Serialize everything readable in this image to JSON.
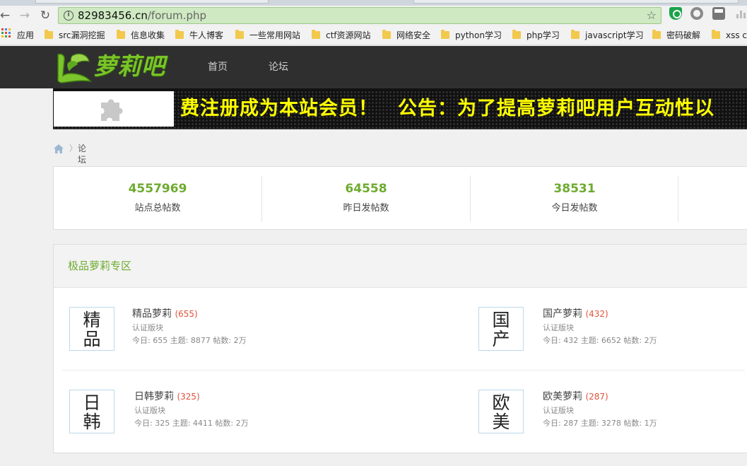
{
  "browser": {
    "url_host": "82983456.cn",
    "url_path": "/forum.php",
    "bookmarks": [
      {
        "label": "应用"
      },
      {
        "label": "src漏洞挖掘"
      },
      {
        "label": "信息收集"
      },
      {
        "label": "牛人博客"
      },
      {
        "label": "一些常用网站"
      },
      {
        "label": "ctf资源网站"
      },
      {
        "label": "网络安全"
      },
      {
        "label": "python学习"
      },
      {
        "label": "php学习"
      },
      {
        "label": "javascript学习"
      },
      {
        "label": "密码破解"
      },
      {
        "label": "xss ch"
      }
    ]
  },
  "site": {
    "logo_text": "萝莉吧",
    "nav": [
      {
        "label": "首页"
      },
      {
        "label": "论坛"
      }
    ],
    "banner_text": "费注册成为本站会员！　公告：为了提高萝莉吧用户互动性以"
  },
  "breadcrumb": {
    "current": "论坛"
  },
  "stats": [
    {
      "value": "4557969",
      "label": "站点总帖数"
    },
    {
      "value": "64558",
      "label": "昨日发帖数"
    },
    {
      "value": "38531",
      "label": "今日发帖数"
    }
  ],
  "section": {
    "title": "极品萝莉专区",
    "forums": [
      {
        "icon_top": "精",
        "icon_bottom": "品",
        "name": "精品萝莉",
        "count": "(655)",
        "sub": "认证版块",
        "meta": "今日: 655 主题: 8877 帖数: 2万"
      },
      {
        "icon_top": "国",
        "icon_bottom": "产",
        "name": "国产萝莉",
        "count": "(432)",
        "sub": "认证版块",
        "meta": "今日: 432 主题: 6652 帖数: 2万"
      },
      {
        "icon_top": "日",
        "icon_bottom": "韩",
        "name": "日韩萝莉",
        "count": "(325)",
        "sub": "认证版块",
        "meta": "今日: 325 主题: 4411 帖数: 2万"
      },
      {
        "icon_top": "欧",
        "icon_bottom": "美",
        "name": "欧美萝莉",
        "count": "(287)",
        "sub": "认证版块",
        "meta": "今日: 287 主题: 3278 帖数: 1万"
      }
    ]
  },
  "colors": {
    "accent_green": "#6eab2f",
    "count_red": "#e0523b",
    "banner_yellow": "#ffff00",
    "header_dark": "#2f2f2f"
  }
}
